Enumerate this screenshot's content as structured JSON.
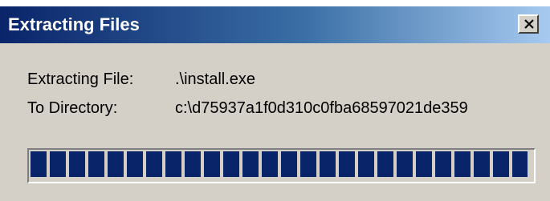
{
  "window": {
    "title": "Extracting Files",
    "close_icon": "close-x-icon"
  },
  "info": {
    "file_label": "Extracting File:",
    "file_value": ".\\install.exe",
    "dir_label": "To Directory:",
    "dir_value": "c:\\d75937a1f0d310c0fba68597021de359"
  },
  "progress": {
    "fraction": 0.99,
    "bar_color": "#0a246a"
  }
}
